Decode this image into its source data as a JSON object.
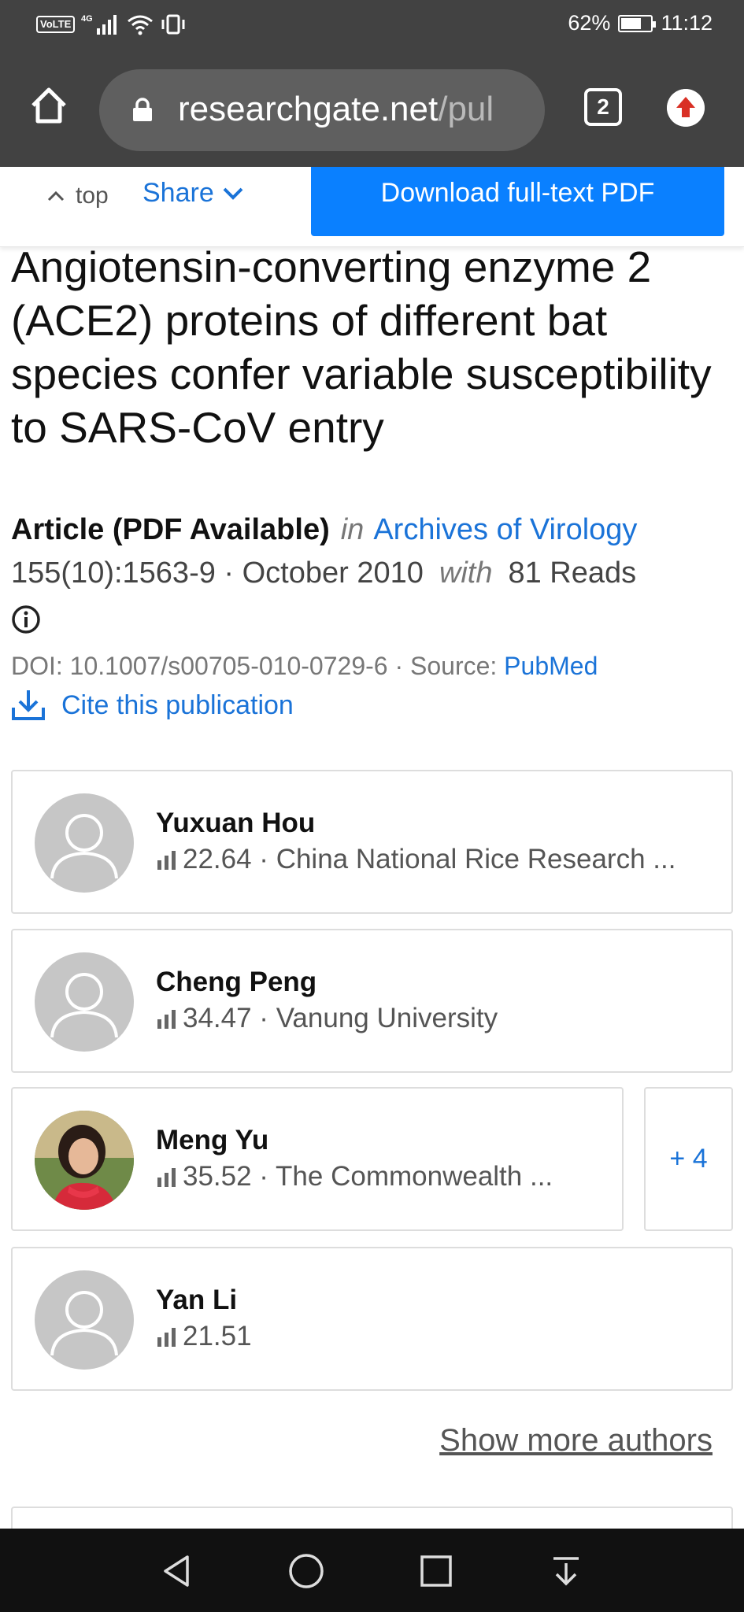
{
  "status_bar": {
    "network": "4G",
    "volte": "VoLTE",
    "battery": "62%",
    "time": "11:12"
  },
  "browser": {
    "url_main": "researchgate.net",
    "url_rest": "/pul",
    "tab_count": "2"
  },
  "toolbar": {
    "top_label": "top",
    "share_label": "Share",
    "download_label": "Download full-text PDF"
  },
  "article": {
    "title": "Angiotensin-converting enzyme 2 (ACE2) proteins of different bat species confer variable susceptibility to SARS-CoV entry",
    "type": "Article (PDF Available)",
    "in_word": "in",
    "journal": "Archives of Virology",
    "volume_date": "155(10):1563-9 · October 2010",
    "with_word": "with",
    "reads": "81 Reads",
    "doi_source": "DOI: 10.1007/s00705-010-0729-6 · Source:",
    "source": "PubMed",
    "cite_label": "Cite this publication"
  },
  "authors": [
    {
      "name": "Yuxuan Hou",
      "stats": "22.64 · China National Rice Research ..."
    },
    {
      "name": "Cheng Peng",
      "stats": "34.47 · Vanung University"
    },
    {
      "name": "Meng Yu",
      "stats": "35.52 · The Commonwealth ..."
    },
    {
      "name": "Yan Li",
      "stats": "21.51"
    }
  ],
  "more_authors_badge": "+ 4",
  "show_more_label": "Show more authors",
  "colors": {
    "link": "#1a73d8",
    "primary_button": "#0a80ff",
    "browser_chrome": "#424242"
  }
}
